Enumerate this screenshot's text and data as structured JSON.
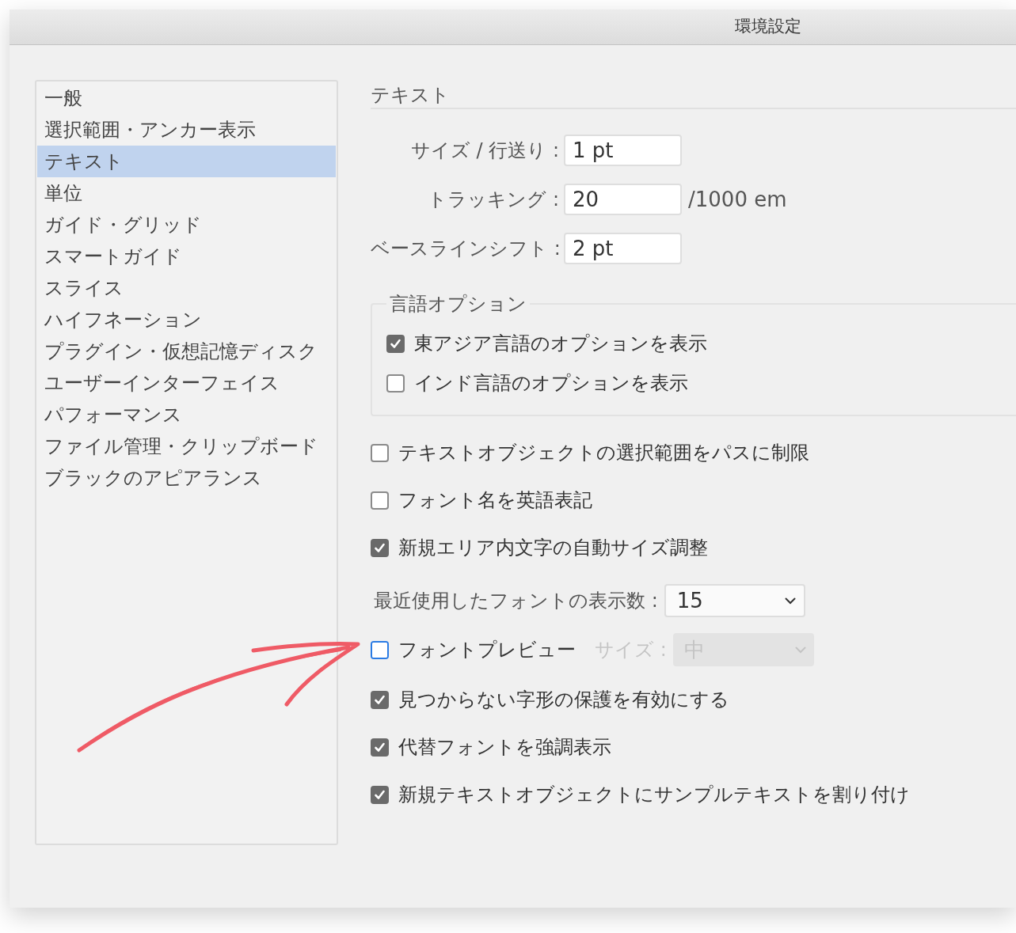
{
  "window": {
    "title": "環境設定"
  },
  "sidebar": {
    "items": [
      {
        "label": "一般",
        "selected": false
      },
      {
        "label": "選択範囲・アンカー表示",
        "selected": false
      },
      {
        "label": "テキスト",
        "selected": true
      },
      {
        "label": "単位",
        "selected": false
      },
      {
        "label": "ガイド・グリッド",
        "selected": false
      },
      {
        "label": "スマートガイド",
        "selected": false
      },
      {
        "label": "スライス",
        "selected": false
      },
      {
        "label": "ハイフネーション",
        "selected": false
      },
      {
        "label": "プラグイン・仮想記憶ディスク",
        "selected": false
      },
      {
        "label": "ユーザーインターフェイス",
        "selected": false
      },
      {
        "label": "パフォーマンス",
        "selected": false
      },
      {
        "label": "ファイル管理・クリップボード",
        "selected": false
      },
      {
        "label": "ブラックのアピアランス",
        "selected": false
      }
    ]
  },
  "section": {
    "title": "テキスト"
  },
  "fields": [
    {
      "label": "サイズ / 行送り :",
      "value": "1 pt"
    },
    {
      "label": "トラッキング :",
      "value": "20",
      "unit": "/1000 em"
    },
    {
      "label": "ベースラインシフト :",
      "value": "2 pt"
    }
  ],
  "language_options": {
    "title": "言語オプション",
    "options": [
      {
        "label": "東アジア言語のオプションを表示",
        "checked": true
      },
      {
        "label": "インド言語のオプションを表示",
        "checked": false
      }
    ]
  },
  "settings": [
    {
      "kind": "checkbox",
      "label": "テキストオブジェクトの選択範囲をパスに制限",
      "checked": false
    },
    {
      "kind": "checkbox",
      "label": "フォント名を英語表記",
      "checked": false
    },
    {
      "kind": "checkbox",
      "label": "新規エリア内文字の自動サイズ調整",
      "checked": true
    },
    {
      "kind": "select",
      "label": "最近使用したフォントの表示数 :",
      "value": "15"
    },
    {
      "kind": "checkbox_select",
      "label": "フォントプレビュー",
      "checked": false,
      "focused": true,
      "select": {
        "label": "サイズ :",
        "value": "中",
        "disabled": true
      }
    },
    {
      "kind": "checkbox",
      "label": "見つからない字形の保護を有効にする",
      "checked": true
    },
    {
      "kind": "checkbox",
      "label": "代替フォントを強調表示",
      "checked": true
    },
    {
      "kind": "checkbox",
      "label": "新規テキストオブジェクトにサンプルテキストを割り付け",
      "checked": true
    }
  ]
}
